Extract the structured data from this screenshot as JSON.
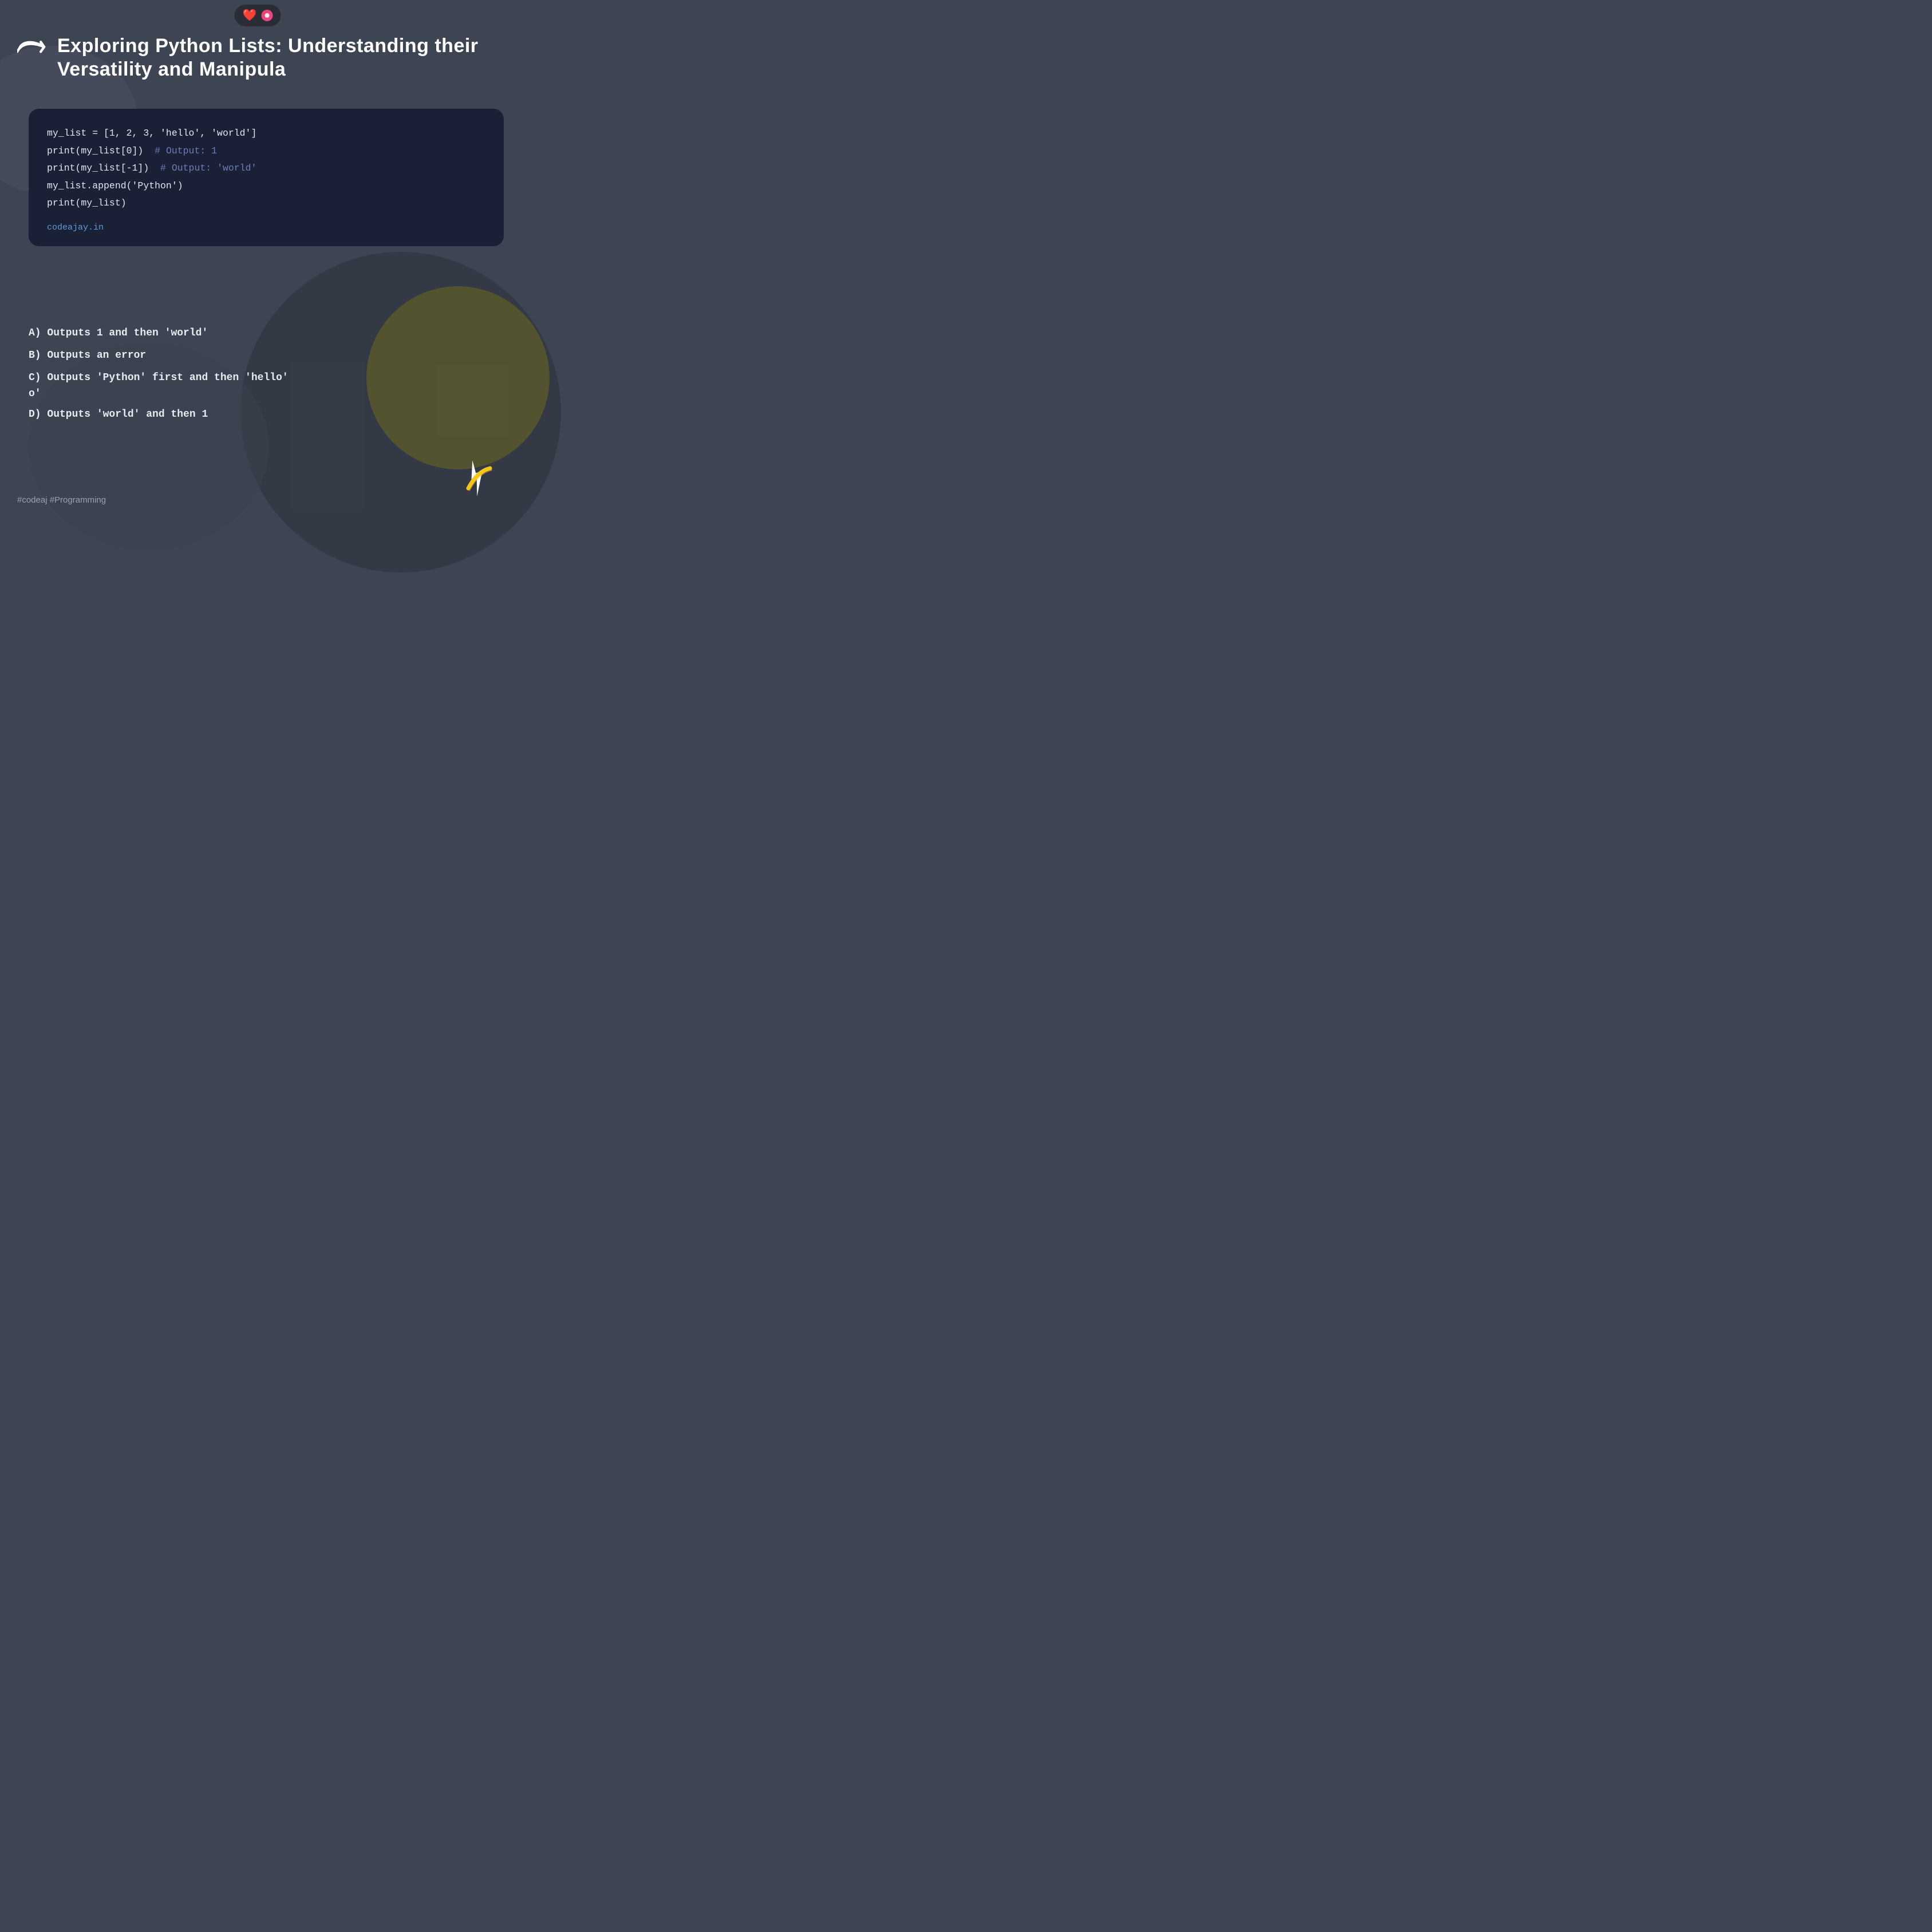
{
  "topbar": {
    "heart_emoji": "❤️",
    "dot_color": "#f43f5e"
  },
  "title": {
    "text": "Exploring Python Lists: Understanding their Versatility and Manipula"
  },
  "code": {
    "lines": [
      "my_list = [1, 2, 3, 'hello', 'world']",
      "print(my_list[0])  # Output: 1",
      "print(my_list[-1])  # Output: 'world'",
      "my_list.append('Python')",
      "print(my_list)"
    ],
    "link": "codeajay.in"
  },
  "options": {
    "a": "A)  Outputs 1 and then 'world'",
    "b": "B)  Outputs an error",
    "c_line1": "C)  Outputs 'Python' first and then 'hello'",
    "c_line2": "o'",
    "d": "D)  Outputs 'world' and then 1"
  },
  "hashtags": "#codeaj #Programming",
  "logo": "⚡"
}
